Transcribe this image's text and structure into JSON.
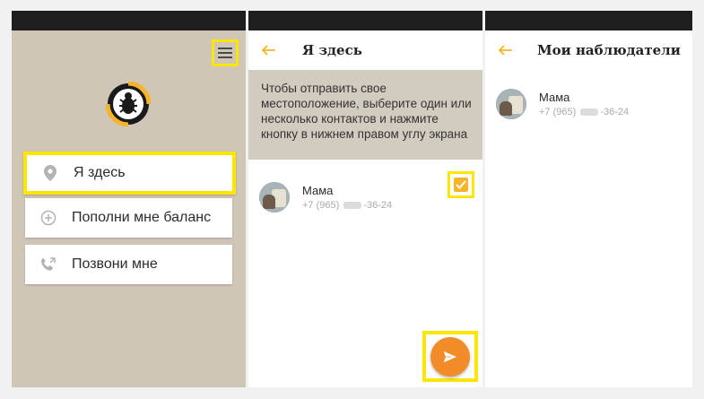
{
  "colors": {
    "accent": "#f4b52b",
    "highlight": "#ffe600",
    "fab": "#f28c28",
    "panel_bg": "#cfc6b8"
  },
  "screen1": {
    "menu_icon": "hamburger-icon",
    "logo_icon": "bug-logo",
    "buttons": [
      {
        "label": "Я здесь",
        "icon": "location-pin-icon"
      },
      {
        "label": "Пополни мне баланс",
        "icon": "plus-circle-icon"
      },
      {
        "label": "Позвони мне",
        "icon": "phone-callback-icon"
      }
    ]
  },
  "screen2": {
    "title": "Я здесь",
    "info": "Чтобы отправить свое местоположение, выберите один или несколько контактов и нажмите кнопку в нижнем правом углу экрана",
    "contact": {
      "name": "Мама",
      "phone_prefix": "+7 (965)",
      "phone_suffix": "-36-24",
      "checked": true
    },
    "send_icon": "send-icon"
  },
  "screen3": {
    "title": "Мои наблюдатели",
    "contact": {
      "name": "Мама",
      "phone_prefix": "+7 (965)",
      "phone_suffix": "-36-24"
    }
  }
}
